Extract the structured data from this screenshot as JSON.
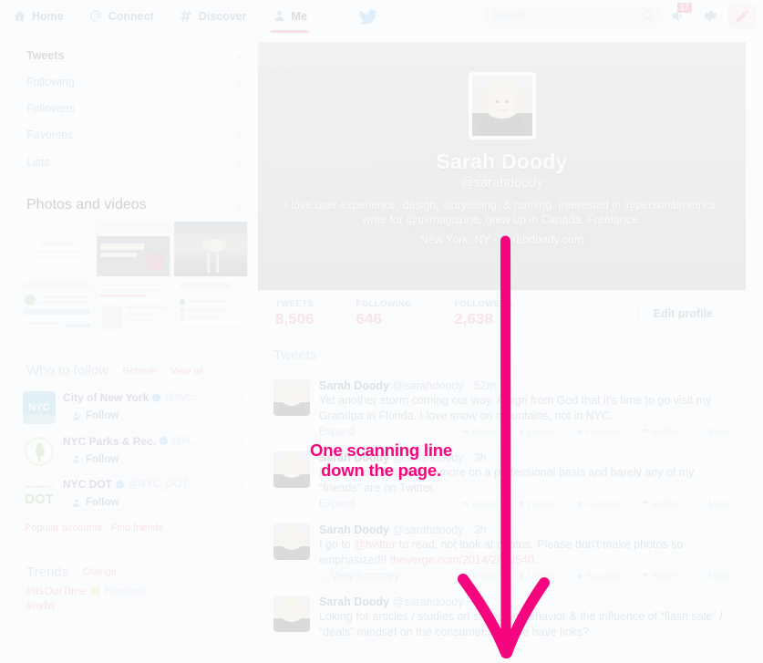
{
  "topnav": {
    "items": [
      {
        "label": "Home",
        "icon": "home-icon",
        "active": false
      },
      {
        "label": "Connect",
        "icon": "at-icon",
        "active": false
      },
      {
        "label": "Discover",
        "icon": "hash-icon",
        "active": false
      },
      {
        "label": "Me",
        "icon": "person-icon",
        "active": true
      }
    ],
    "logo": "twitter-bird-icon",
    "search": {
      "placeholder": "Search",
      "icon": "search-icon"
    },
    "notifications": {
      "icon": "megaphone-icon",
      "count": "17"
    },
    "settings": {
      "icon": "gear-icon"
    },
    "compose": {
      "icon": "compose-tweet-icon"
    }
  },
  "sidebar": {
    "nav": [
      {
        "label": "Tweets"
      },
      {
        "label": "Following"
      },
      {
        "label": "Followers"
      },
      {
        "label": "Favorites"
      },
      {
        "label": "Lists"
      }
    ],
    "photos": {
      "title": "Photos and videos"
    },
    "who_to_follow": {
      "title": "Who to follow",
      "refresh": "Refresh",
      "view_all": "View all",
      "separator": "·",
      "accounts": [
        {
          "name": "City of New York",
          "handle": "@nyc...",
          "verified": true,
          "follow": "Follow",
          "avatar": "nyc-logo"
        },
        {
          "name": "NYC Parks & Rec.",
          "handle": "@N...",
          "verified": true,
          "follow": "Follow",
          "avatar": "leaf-logo"
        },
        {
          "name": "NYC DOT",
          "handle": "@NYC_DOT",
          "verified": true,
          "follow": "Follow",
          "avatar": "dot-logo"
        }
      ],
      "footer_links": [
        "Popular accounts",
        "Find friends"
      ]
    },
    "trends": {
      "title": "Trends",
      "change": "Change",
      "items": [
        {
          "tag": "#ItsOurTime",
          "promoted": "Promoted"
        },
        {
          "tag": "#nyfw",
          "promoted": ""
        }
      ]
    }
  },
  "profile": {
    "name": "Sarah Doody",
    "handle": "@sarahdoody",
    "bio": "I love user experience, design, storytelling, & running. Interested in @personalmetrics, write for @uxmagazine, grew up in Canada. Freelance.",
    "location_and_site": "New York, NY · sarahdoody.com",
    "stats": [
      {
        "label": "TWEETS",
        "value": "8,506"
      },
      {
        "label": "FOLLOWING",
        "value": "646"
      },
      {
        "label": "FOLLOWERS",
        "value": "2,638"
      }
    ],
    "edit_button": "Edit profile"
  },
  "timeline": {
    "title": "Tweets",
    "actions": [
      "Reply",
      "Delete",
      "Favorite",
      "Buffer",
      "More"
    ],
    "tweets": [
      {
        "name": "Sarah Doody",
        "handle": "@sarahdoody",
        "time": "52m",
        "text": "Yet another storm coming our way. A sign from God that it's time to go visit my Grandpa in Florida. I love snow on mountains, not in NYC.",
        "sub": "Expand"
      },
      {
        "name": "Sarah Doody",
        "handle": "@sarahdoody",
        "time": "3h",
        "text_before": "But, I also use ",
        "text_link": "@twitter",
        "text_after": " more on a professional basis and barely any of my “friends” are on Twitter.",
        "sub": "Expand"
      },
      {
        "name": "Sarah Doody",
        "handle": "@sarahdoody",
        "time": "3h",
        "text_before": "I go to ",
        "text_link": "@twitter",
        "text_after": " to read, not look at photos. Please don't make photos so emphasized!! ",
        "text_link2": "theverge.com/2014/2/11/540...",
        "sub": "View summary"
      },
      {
        "name": "Sarah Doody",
        "handle": "@sarahdoody",
        "time": "3h",
        "text": "Loking for articles / studies on shopping behavior & the influence of “flash sale” / “deals” mindset on the consumer. Anyone have links?",
        "sub": ""
      }
    ]
  },
  "annotation": {
    "line1": "One scanning line",
    "line2": "down the page.",
    "color": "#f5067f"
  }
}
